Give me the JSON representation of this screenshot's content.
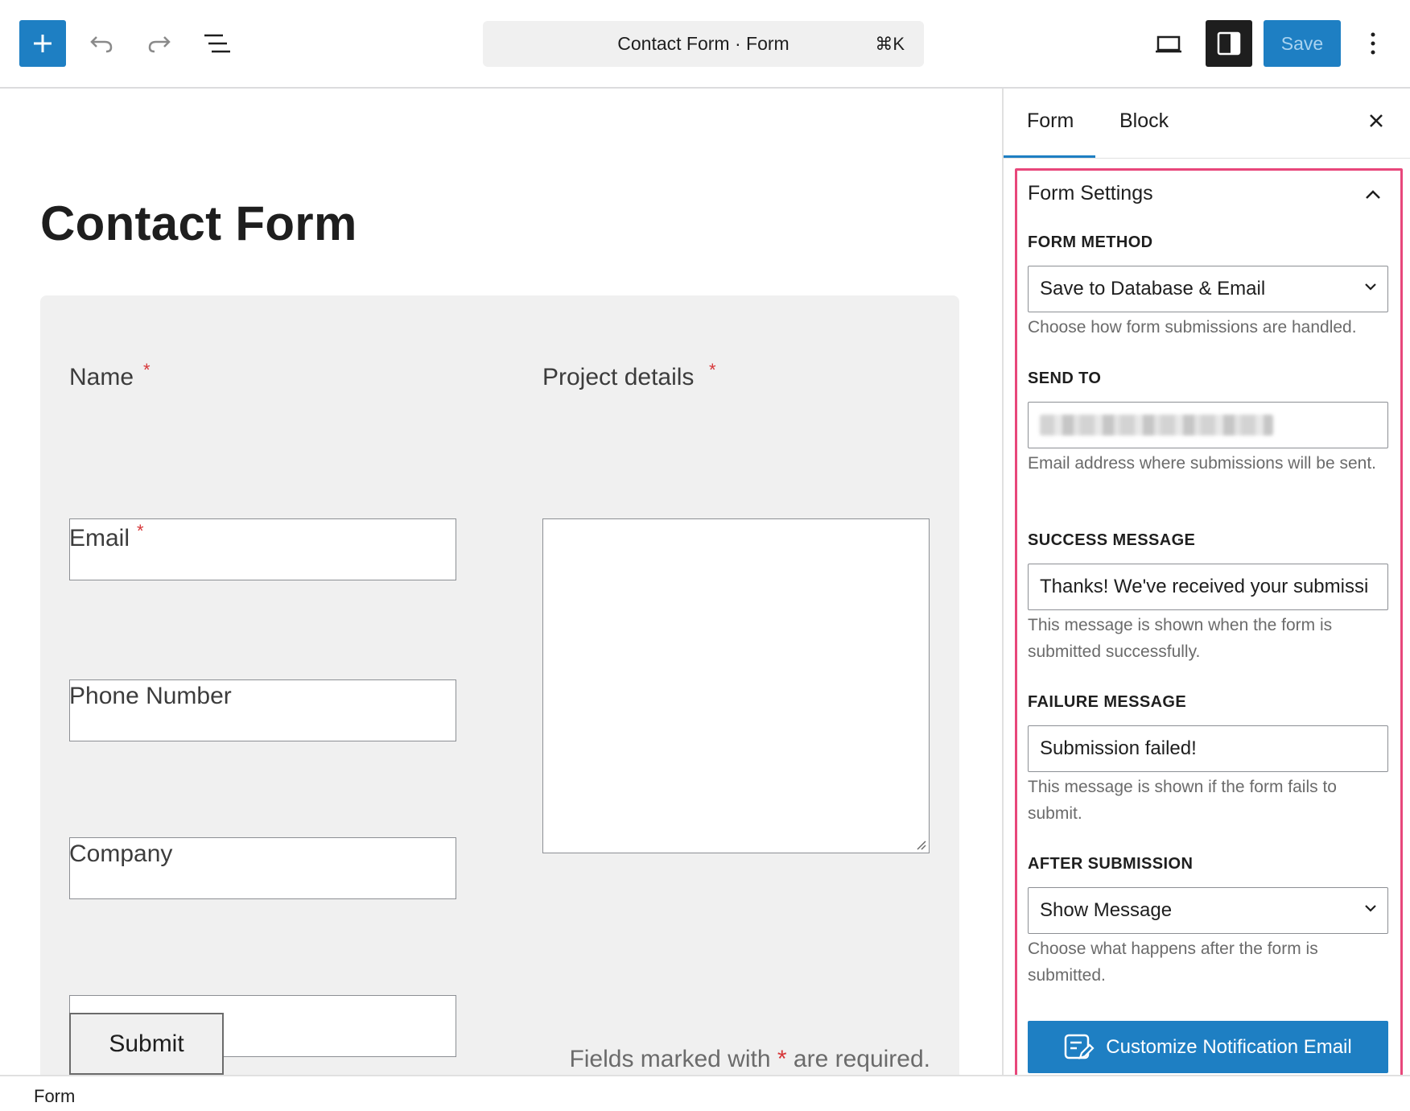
{
  "toolbar": {
    "document_title": "Contact Form · Form",
    "shortcut": "⌘K",
    "save_label": "Save"
  },
  "canvas": {
    "page_title": "Contact Form",
    "fields": {
      "name_label": "Name",
      "email_label": "Email",
      "phone_label": "Phone Number",
      "company_label": "Company",
      "project_label": "Project details",
      "required_marker": "*"
    },
    "required_note": {
      "prefix": "Fields marked with",
      "star": "*",
      "suffix": "are required."
    },
    "submit_label": "Submit"
  },
  "sidebar": {
    "tabs": [
      {
        "label": "Form",
        "active": true
      },
      {
        "label": "Block",
        "active": false
      }
    ],
    "panel": {
      "title": "Form Settings",
      "form_method": {
        "label": "FORM METHOD",
        "value": "Save to Database & Email",
        "help": "Choose how form submissions are handled."
      },
      "send_to": {
        "label": "SEND TO",
        "help": "Email address where submissions will be sent."
      },
      "success_message": {
        "label": "SUCCESS MESSAGE",
        "value": "Thanks! We've received your submissi",
        "help": "This message is shown when the form is submitted successfully."
      },
      "failure_message": {
        "label": "FAILURE MESSAGE",
        "value": "Submission failed!",
        "help": "This message is shown if the form fails to submit."
      },
      "after_submission": {
        "label": "AFTER SUBMISSION",
        "value": "Show Message",
        "help": "Choose what happens after the form is submitted."
      },
      "cta_label": "Customize Notification Email"
    }
  },
  "footer": {
    "breadcrumb": "Form"
  },
  "colors": {
    "accent": "#1e7fc3",
    "highlight_border": "#e8477b",
    "required": "#d63638",
    "form_background": "#f0f0f0"
  }
}
